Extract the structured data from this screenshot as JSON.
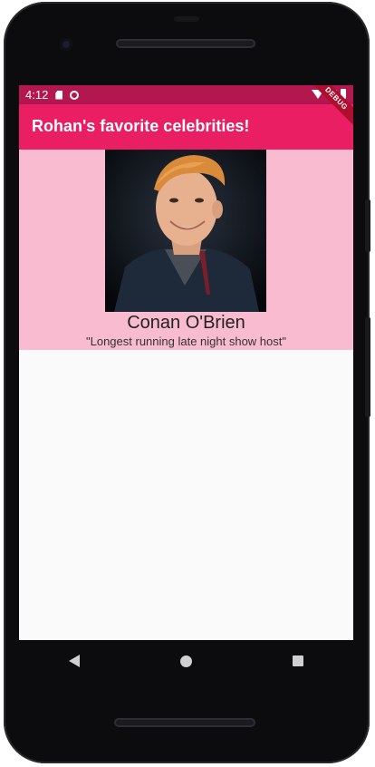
{
  "status_bar": {
    "time": "4:12",
    "icons": [
      "sd-card-icon",
      "sync-icon",
      "wifi-icon",
      "signal-icon",
      "battery-icon"
    ]
  },
  "app_bar": {
    "title": "Rohan's favorite celebrities!"
  },
  "debug_banner": {
    "text": "DEBUG"
  },
  "celebrity": {
    "name": "Conan O'Brien",
    "quote": "\"Longest running late night show host\""
  },
  "colors": {
    "status_bar": "#b2174e",
    "app_bar": "#e91e63",
    "card_background": "#f8bbd0",
    "debug_banner": "#b00e2f",
    "screen_background": "#fafafa"
  },
  "navigation": {
    "icons": [
      "back-icon",
      "home-icon",
      "recents-icon"
    ]
  }
}
